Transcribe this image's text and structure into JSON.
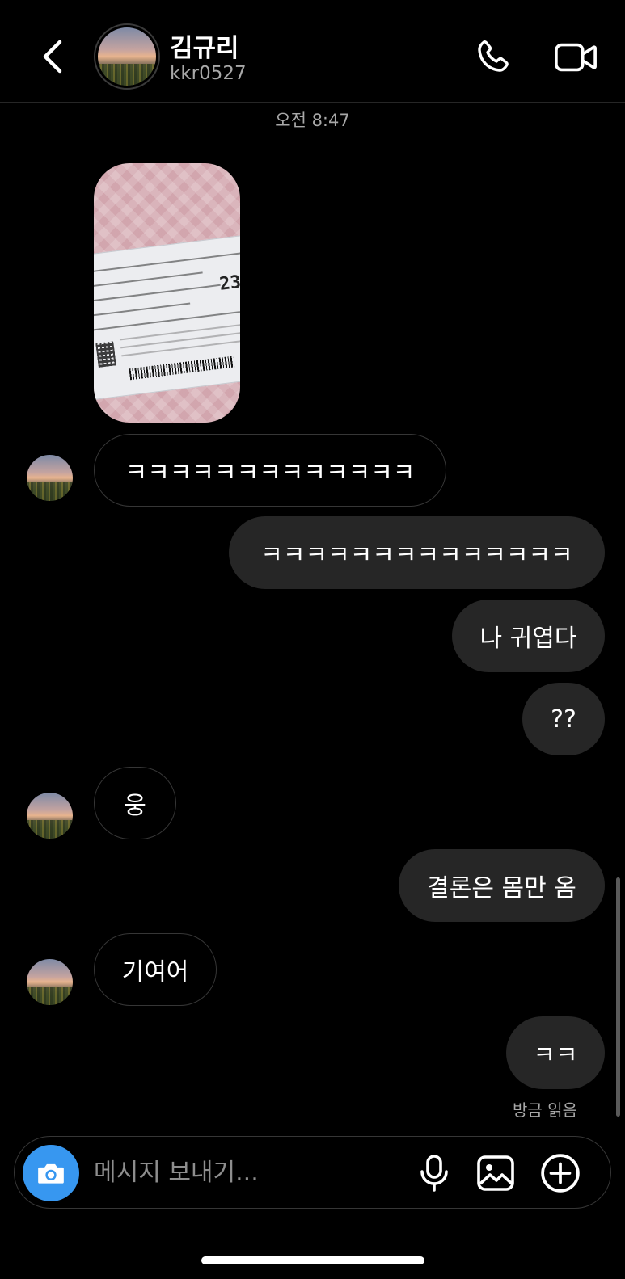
{
  "header": {
    "back_icon": "chevron-left-icon",
    "contact_name": "김규리",
    "contact_handle": "kkr0527",
    "call_icon": "phone-icon",
    "video_icon": "video-camera-icon"
  },
  "thread": {
    "timestamp": "오전 8:47",
    "messages": [
      {
        "direction": "incoming",
        "type": "photo",
        "description_icon": "photo-ticket"
      },
      {
        "direction": "incoming",
        "type": "text",
        "text": "ㅋㅋㅋㅋㅋㅋㅋㅋㅋㅋㅋㅋㅋ"
      },
      {
        "direction": "outgoing",
        "type": "text",
        "text": "ㅋㅋㅋㅋㅋㅋㅋㅋㅋㅋㅋㅋㅋㅋ"
      },
      {
        "direction": "outgoing",
        "type": "text",
        "text": "나 귀엽다"
      },
      {
        "direction": "outgoing",
        "type": "text",
        "text": "??"
      },
      {
        "direction": "incoming",
        "type": "text",
        "text": "웅"
      },
      {
        "direction": "outgoing",
        "type": "text",
        "text": "결론은 몸만 옴"
      },
      {
        "direction": "incoming",
        "type": "text",
        "text": "기여어"
      },
      {
        "direction": "outgoing",
        "type": "text",
        "text": "ㅋㅋ"
      }
    ],
    "read_receipt": "방금 읽음"
  },
  "composer": {
    "placeholder": "메시지 보내기...",
    "camera_icon": "camera-icon",
    "mic_icon": "microphone-icon",
    "gallery_icon": "image-icon",
    "plus_icon": "plus-circle-icon"
  },
  "colors": {
    "background": "#000000",
    "outgoing_bubble": "#262626",
    "incoming_border": "#363636",
    "accent": "#3797f0",
    "secondary_text": "#a8a8a8"
  }
}
